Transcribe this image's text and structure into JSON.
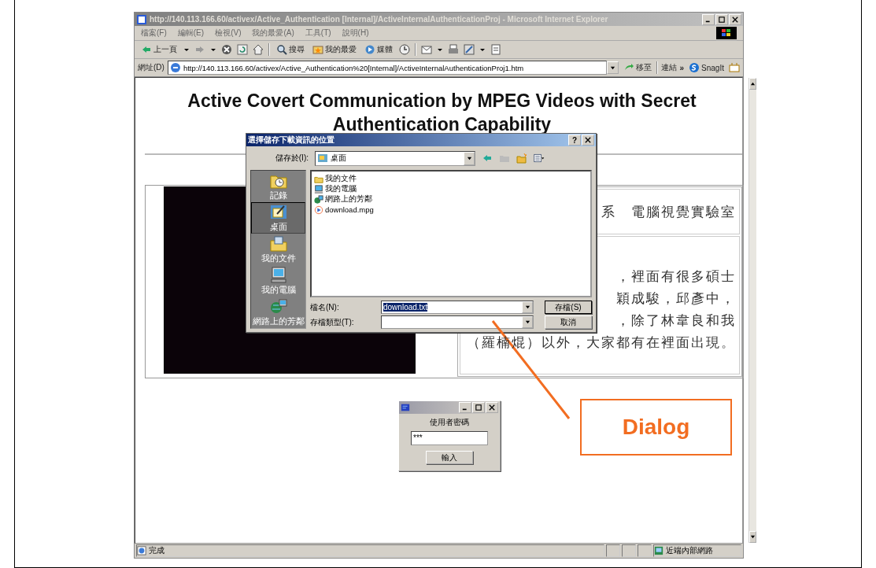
{
  "browser": {
    "title": "http://140.113.166.60/activex/Active_Authentication [Internal]/ActiveInternalAuthenticationProj - Microsoft Internet Explorer",
    "menu": [
      "檔案(F)",
      "編輯(E)",
      "檢視(V)",
      "我的最愛(A)",
      "工具(T)",
      "說明(H)"
    ],
    "toolbar": [
      {
        "kind": "back",
        "label": "上一頁"
      },
      {
        "kind": "search",
        "label": "搜尋"
      },
      {
        "kind": "favorites",
        "label": "我的最愛"
      },
      {
        "kind": "media",
        "label": "媒體"
      }
    ],
    "address": {
      "label": "網址(D)",
      "url": "http://140.113.166.60/activex/Active_Authentication%20[Internal]/ActiveInternalAuthenticationProj1.htm",
      "go": "移至",
      "links": "連結",
      "more": "»",
      "snagit": "SnagIt"
    }
  },
  "page": {
    "heading": "Active Covert Communication by MPEG Videos with Secret Authentication Capability",
    "lab": "系　電腦視覺實驗室",
    "lines": [
      "，裡面有很多碩士",
      "穎成駿，邱彥中，",
      "，除了林韋良和我",
      "（羅楠焜）以外，大家都有在裡面出現。"
    ]
  },
  "save_dialog": {
    "title": "選擇儲存下載資訊的位置",
    "help": "?",
    "save_in_label": "儲存於(I):",
    "save_in": "桌面",
    "places": [
      {
        "label": "記錄",
        "kind": "history",
        "selected": false
      },
      {
        "label": "桌面",
        "kind": "desktop",
        "selected": true
      },
      {
        "label": "我的文件",
        "kind": "documents",
        "selected": false
      },
      {
        "label": "我的電腦",
        "kind": "computer",
        "selected": false
      },
      {
        "label": "網路上的芳鄰",
        "kind": "network",
        "selected": false
      }
    ],
    "files": [
      {
        "label": "我的文件",
        "kind": "documents"
      },
      {
        "label": "我的電腦",
        "kind": "computer"
      },
      {
        "label": "網路上的芳鄰",
        "kind": "network"
      },
      {
        "label": "download.mpg",
        "kind": "video"
      }
    ],
    "filename_label": "檔名(N):",
    "filename": "download.txt",
    "filename_selected": true,
    "type_label": "存檔類型(T):",
    "buttons": [
      "存檔(S)",
      "取消"
    ]
  },
  "password_dialog": {
    "label": "使用者密碼",
    "value": "***",
    "button": "輸入"
  },
  "status_bar": {
    "text": "完成",
    "zone": "近端內部網路"
  },
  "callout": {
    "label": "Dialog"
  }
}
